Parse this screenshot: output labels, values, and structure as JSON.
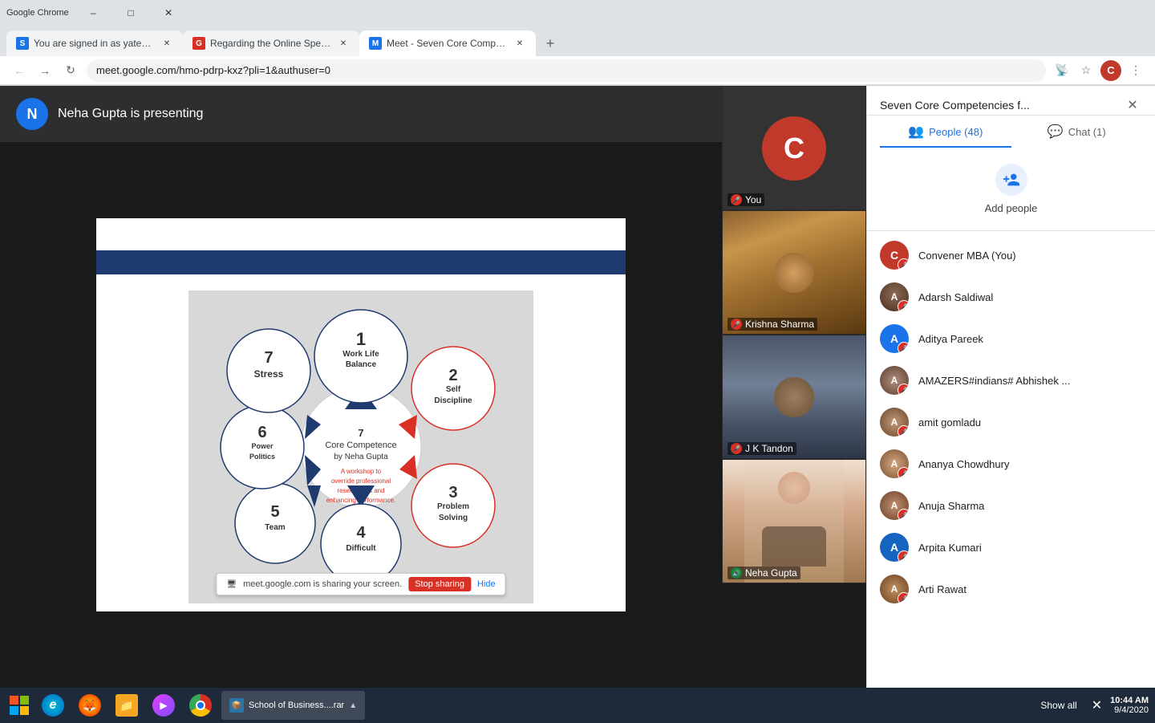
{
  "browser": {
    "tabs": [
      {
        "id": "tab1",
        "favicon_color": "#1a73e8",
        "favicon_letter": "S",
        "title": "You are signed in as yatendra_ve...",
        "active": false
      },
      {
        "id": "tab2",
        "favicon_color": "#d93025",
        "favicon_letter": "G",
        "title": "Regarding the Online Special Ba...",
        "active": false
      },
      {
        "id": "tab3",
        "favicon_color": "#1a73e8",
        "favicon_letter": "M",
        "title": "Meet - Seven Core Compete...",
        "active": true
      }
    ],
    "url": "meet.google.com/hmo-pdrp-kxz?pli=1&authuser=0",
    "profile_letter": "C"
  },
  "meeting": {
    "presenter_initial": "N",
    "presenter_name": "Neha Gupta is presenting",
    "panel_title": "Seven Core Competencies f...",
    "screen_share_text": "meet.google.com is sharing your screen.",
    "stop_sharing_label": "Stop sharing",
    "hide_label": "Hide"
  },
  "participants_panel": {
    "people_tab_label": "People (48)",
    "chat_tab_label": "Chat (1)",
    "add_people_label": "Add people",
    "close_label": "×",
    "people": [
      {
        "id": "p1",
        "name": "Convener MBA (You)",
        "avatar_color": "#c0392b",
        "avatar_letter": "C",
        "has_photo": false,
        "mic_off": true
      },
      {
        "id": "p2",
        "name": "Adarsh Saldiwal",
        "avatar_color": "#5c4033",
        "avatar_letter": "A",
        "has_photo": true,
        "photo_style": "adarsh",
        "mic_off": true
      },
      {
        "id": "p3",
        "name": "Aditya Pareek",
        "avatar_color": "#1a73e8",
        "avatar_letter": "A",
        "has_photo": false,
        "mic_off": true
      },
      {
        "id": "p4",
        "name": "AMAZERS#indians# Abhishek ...",
        "avatar_color": "#5c4033",
        "avatar_letter": "A",
        "has_photo": true,
        "photo_style": "amazers",
        "mic_off": true
      },
      {
        "id": "p5",
        "name": "amit gomladu",
        "avatar_color": "#5c4033",
        "avatar_letter": "A",
        "has_photo": true,
        "photo_style": "amit",
        "mic_off": true
      },
      {
        "id": "p6",
        "name": "Ananya Chowdhury",
        "avatar_color": "#5c4033",
        "avatar_letter": "A",
        "has_photo": true,
        "photo_style": "ananya",
        "mic_off": true
      },
      {
        "id": "p7",
        "name": "Anuja Sharma",
        "avatar_color": "#5c4033",
        "avatar_letter": "A",
        "has_photo": true,
        "photo_style": "anuja",
        "mic_off": true
      },
      {
        "id": "p8",
        "name": "Arpita Kumari",
        "avatar_color": "#1565c0",
        "avatar_letter": "A",
        "has_photo": false,
        "mic_off": true
      },
      {
        "id": "p9",
        "name": "Arti Rawat",
        "avatar_color": "#5c4033",
        "avatar_letter": "A",
        "has_photo": true,
        "photo_style": "arti",
        "mic_off": true
      }
    ]
  },
  "video_tiles": [
    {
      "id": "v1",
      "label": "You",
      "mic_off": true,
      "type": "placeholder_c"
    },
    {
      "id": "v2",
      "label": "Krishna Sharma",
      "mic_off": true,
      "type": "face_krishna"
    },
    {
      "id": "v3",
      "label": "J K Tandon",
      "mic_off": true,
      "type": "face_jk"
    },
    {
      "id": "v4",
      "label": "Neha Gupta",
      "speaking": true,
      "type": "face_neha"
    }
  ],
  "taskbar": {
    "item_text": "School of Business....rar",
    "show_all_label": "Show all",
    "clock_time": "10:44 AM",
    "clock_date": "9/4/2020"
  },
  "slide": {
    "title": "7 Core Competence",
    "subtitle": "by Neha Gupta",
    "tagline": "A workshop to override professional reservations and enhancing performance.",
    "circles": [
      {
        "num": "1",
        "label": "Work Life Balance",
        "angle": 270
      },
      {
        "num": "2",
        "label": "Self Discipline",
        "angle": 342
      },
      {
        "num": "3",
        "label": "Problem Solving",
        "angle": 54
      },
      {
        "num": "4",
        "label": "Difficult",
        "angle": 126
      },
      {
        "num": "5",
        "label": "Team",
        "angle": 198
      },
      {
        "num": "6",
        "label": "Power Politics",
        "angle": 234
      },
      {
        "num": "7",
        "label": "Stress",
        "angle": 306
      }
    ]
  }
}
